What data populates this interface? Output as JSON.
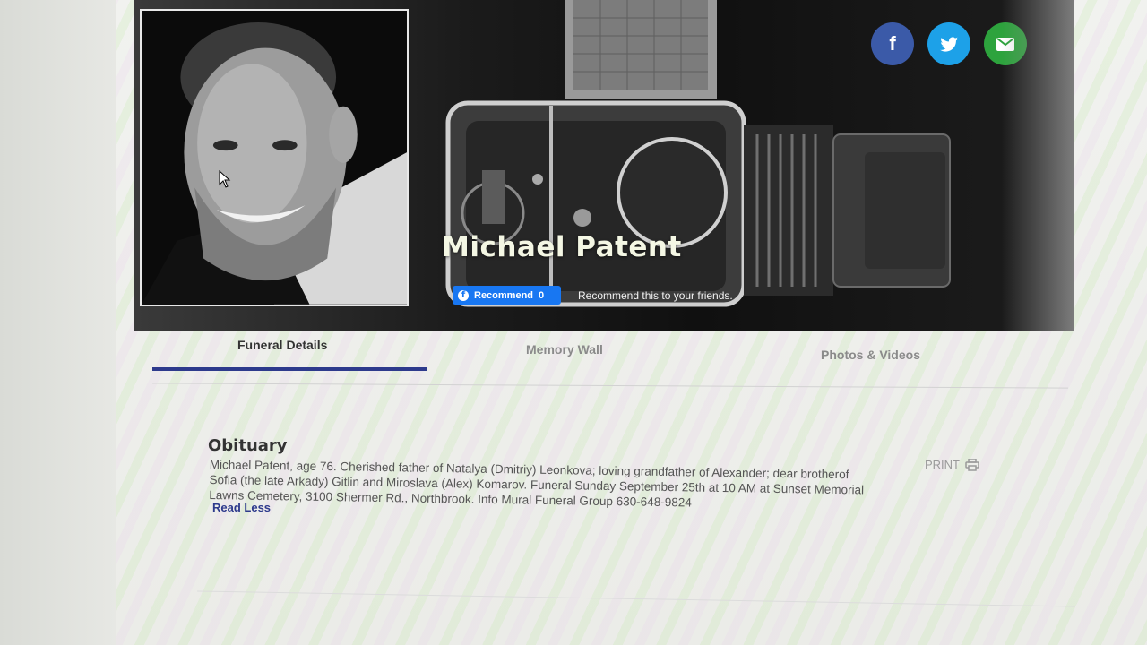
{
  "hero": {
    "name": "Michael Patent",
    "recommend_label": "Recommend",
    "recommend_count": "0",
    "recommend_text": "Recommend this to your friends."
  },
  "share": {
    "facebook_glyph": "f",
    "twitter_icon": "twitter-bird-icon",
    "email_icon": "envelope-icon",
    "colors": {
      "facebook": "#3b5aa8",
      "twitter": "#1da1e8",
      "email": "#2da33d"
    }
  },
  "tabs": [
    {
      "label": "Funeral Details",
      "active": true
    },
    {
      "label": "Memory Wall",
      "active": false
    },
    {
      "label": "Photos & Videos",
      "active": false
    }
  ],
  "obituary": {
    "title": "Obituary",
    "line1": "Michael Patent, age 76. Cherished father of Natalya (Dmitriy) Leonkova; loving grandfather of Alexander; dear brotherof",
    "line2": "Sofia (the late Arkady) Gitlin and Miroslava (Alex) Komarov. Funeral Sunday September 25th at 10 AM at Sunset Memorial",
    "line3": "Lawns Cemetery, 3100 Shermer Rd., Northbrook. Info Mural Funeral Group 630-648-9824",
    "read_less": "Read Less",
    "print_label": "PRINT"
  },
  "accent_color": "#2d3a8c"
}
